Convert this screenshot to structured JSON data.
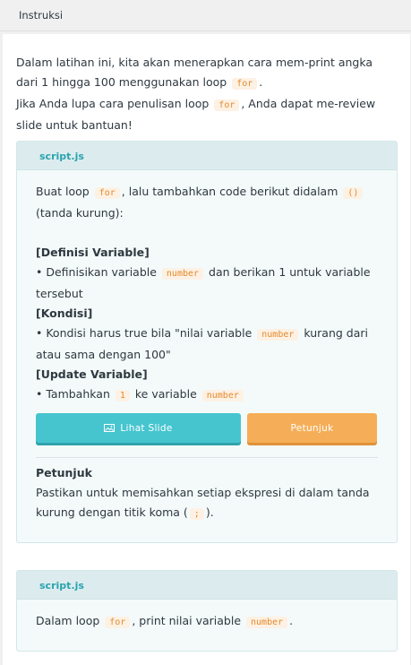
{
  "header": {
    "title": "Instruksi"
  },
  "intro": {
    "line1_before": "Dalam latihan ini, kita akan menerapkan cara mem-print angka dari 1 hingga 100 menggunakan loop",
    "line1_code": "for",
    "line1_after": ".",
    "line2_before": "Jika Anda lupa cara penulisan loop",
    "line2_code": "for",
    "line2_after": ", Anda dapat me-review slide untuk bantuan!"
  },
  "task1": {
    "tab_label": "script.js",
    "p1_a": "Buat loop",
    "p1_code1": "for",
    "p1_b": ", lalu tambahkan code berikut didalam",
    "p1_code2": "()",
    "p1_c": "(tanda kurung):",
    "s1_title": "[Definisi Variable]",
    "s1_a": "• Definisikan variable",
    "s1_code": "number",
    "s1_b": "dan berikan 1 untuk variable tersebut",
    "s2_title": "[Kondisi]",
    "s2_a": "• Kondisi harus true bila \"nilai variable",
    "s2_code": "number",
    "s2_b": "kurang dari atau sama dengan 100\"",
    "s3_title": "[Update Variable]",
    "s3_a": "• Tambahkan",
    "s3_code1": "1",
    "s3_b": "ke variable",
    "s3_code2": "number",
    "btn_slide": "Lihat Slide",
    "btn_hint": "Petunjuk",
    "hint_title": "Petunjuk",
    "hint_a": "Pastikan untuk memisahkan setiap ekspresi di dalam tanda kurung dengan titik koma (",
    "hint_code": ";",
    "hint_b": ")."
  },
  "task2": {
    "tab_label": "script.js",
    "p_a": "Dalam loop",
    "p_code1": "for",
    "p_b": ", print nilai variable",
    "p_code2": "number",
    "p_c": "."
  },
  "colors": {
    "accent": "#2aa3ae",
    "button_slide": "#46c5cf",
    "button_hint": "#f5ae57",
    "code": "#e58a2b"
  },
  "icons": {
    "slide_button": "image-icon"
  }
}
